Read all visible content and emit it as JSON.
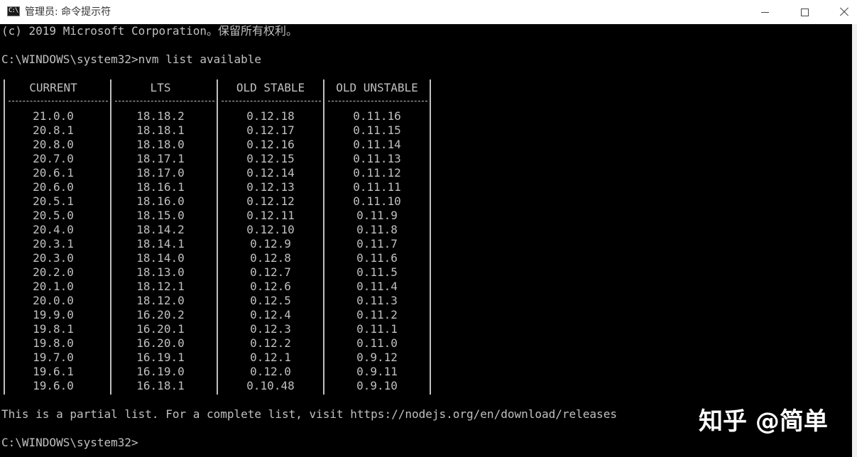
{
  "window": {
    "title": "管理员: 命令提示符",
    "icon": "cmd-icon",
    "icon_glyph": "C:\\",
    "buttons": {
      "minimize": "minimize-icon",
      "maximize": "maximize-icon",
      "close": "close-icon"
    }
  },
  "console": {
    "copyright_line": "(c) 2019 Microsoft Corporation。保留所有权利。",
    "command_line": "C:\\WINDOWS\\system32>nvm list available",
    "table": {
      "headers": [
        "CURRENT",
        "LTS",
        "OLD STABLE",
        "OLD UNSTABLE"
      ],
      "rows": [
        [
          "21.0.0",
          "18.18.2",
          "0.12.18",
          "0.11.16"
        ],
        [
          "20.8.1",
          "18.18.1",
          "0.12.17",
          "0.11.15"
        ],
        [
          "20.8.0",
          "18.18.0",
          "0.12.16",
          "0.11.14"
        ],
        [
          "20.7.0",
          "18.17.1",
          "0.12.15",
          "0.11.13"
        ],
        [
          "20.6.1",
          "18.17.0",
          "0.12.14",
          "0.11.12"
        ],
        [
          "20.6.0",
          "18.16.1",
          "0.12.13",
          "0.11.11"
        ],
        [
          "20.5.1",
          "18.16.0",
          "0.12.12",
          "0.11.10"
        ],
        [
          "20.5.0",
          "18.15.0",
          "0.12.11",
          "0.11.9"
        ],
        [
          "20.4.0",
          "18.14.2",
          "0.12.10",
          "0.11.8"
        ],
        [
          "20.3.1",
          "18.14.1",
          "0.12.9",
          "0.11.7"
        ],
        [
          "20.3.0",
          "18.14.0",
          "0.12.8",
          "0.11.6"
        ],
        [
          "20.2.0",
          "18.13.0",
          "0.12.7",
          "0.11.5"
        ],
        [
          "20.1.0",
          "18.12.1",
          "0.12.6",
          "0.11.4"
        ],
        [
          "20.0.0",
          "18.12.0",
          "0.12.5",
          "0.11.3"
        ],
        [
          "19.9.0",
          "16.20.2",
          "0.12.4",
          "0.11.2"
        ],
        [
          "19.8.1",
          "16.20.1",
          "0.12.3",
          "0.11.1"
        ],
        [
          "19.8.0",
          "16.20.0",
          "0.12.2",
          "0.11.0"
        ],
        [
          "19.7.0",
          "16.19.1",
          "0.12.1",
          "0.9.12"
        ],
        [
          "19.6.1",
          "16.19.0",
          "0.12.0",
          "0.9.11"
        ],
        [
          "19.6.0",
          "16.18.1",
          "0.10.48",
          "0.9.10"
        ]
      ]
    },
    "partial_note": "This is a partial list. For a complete list, visit https://nodejs.org/en/download/releases",
    "prompt": "C:\\WINDOWS\\system32>"
  },
  "watermark": "知乎 @简单",
  "colors": {
    "console_bg": "#000000",
    "console_text": "#c0c0c0",
    "titlebar_bg": "#ffffff"
  }
}
